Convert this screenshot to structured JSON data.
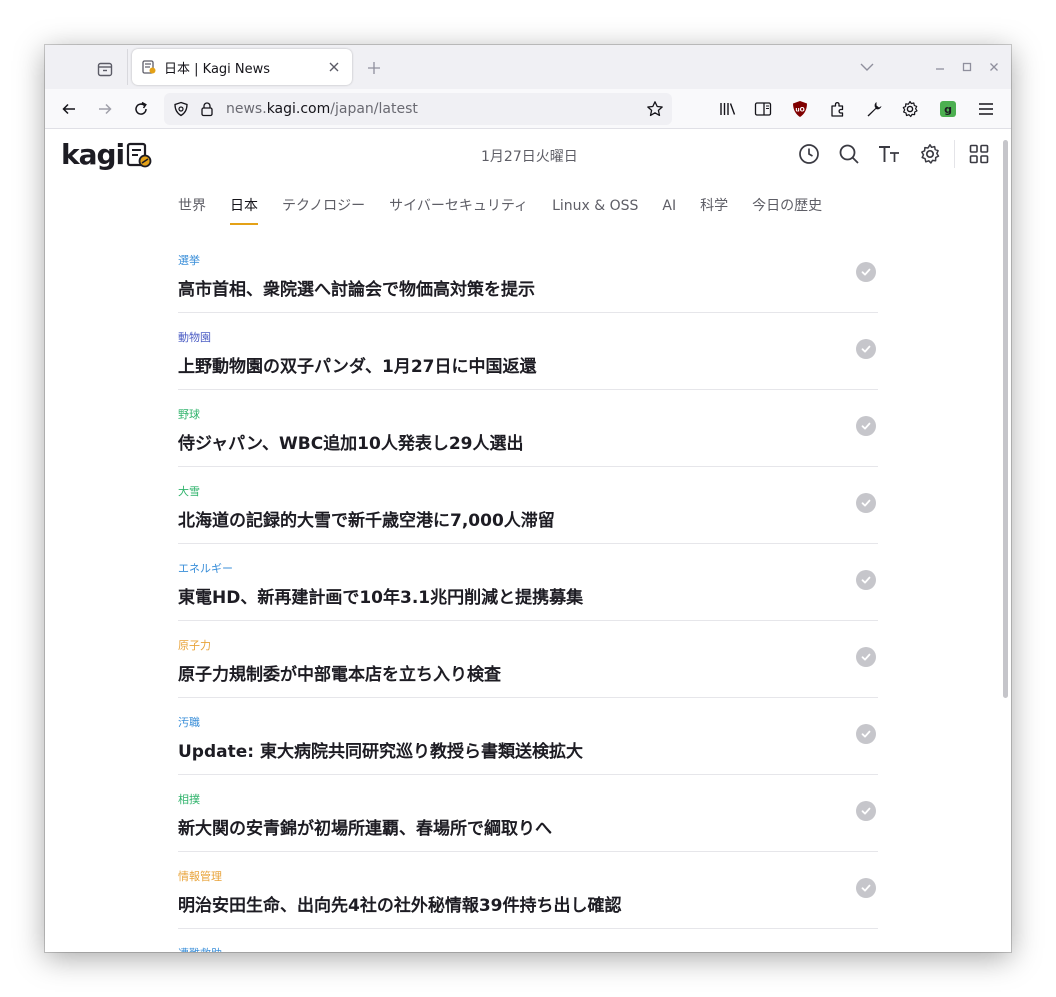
{
  "browser": {
    "tab": {
      "title": "日本 | Kagi News"
    },
    "url": {
      "prefix": "news.",
      "host": "kagi.com",
      "path": "/japan/latest"
    }
  },
  "page": {
    "logo_text": "kagi",
    "date": "1月27日火曜日",
    "categories": [
      {
        "label": "世界"
      },
      {
        "label": "日本",
        "active": true
      },
      {
        "label": "テクノロジー"
      },
      {
        "label": "サイバーセキュリティ"
      },
      {
        "label": "Linux & OSS"
      },
      {
        "label": "AI"
      },
      {
        "label": "科学"
      },
      {
        "label": "今日の歴史"
      }
    ],
    "stories": [
      {
        "tag": "選挙",
        "tag_color": "#3b8fd9",
        "headline": "高市首相、衆院選へ討論会で物価高対策を提示"
      },
      {
        "tag": "動物園",
        "tag_color": "#4b5cc4",
        "headline": "上野動物園の双子パンダ、1月27日に中国返還"
      },
      {
        "tag": "野球",
        "tag_color": "#2fb36b",
        "headline": "侍ジャパン、WBC追加10人発表し29人選出"
      },
      {
        "tag": "大雪",
        "tag_color": "#2fb36b",
        "headline": "北海道の記録的大雪で新千歳空港に7,000人滞留"
      },
      {
        "tag": "エネルギー",
        "tag_color": "#3b8fd9",
        "headline": "東電HD、新再建計画で10年3.1兆円削減と提携募集"
      },
      {
        "tag": "原子力",
        "tag_color": "#e8a33a",
        "headline": "原子力規制委が中部電本店を立ち入り検査"
      },
      {
        "tag": "汚職",
        "tag_color": "#3b8fd9",
        "headline": "Update: 東大病院共同研究巡り教授ら書類送検拡大"
      },
      {
        "tag": "相撲",
        "tag_color": "#2fb36b",
        "headline": "新大関の安青錦が初場所連覇、春場所で綱取りへ"
      },
      {
        "tag": "情報管理",
        "tag_color": "#e8a33a",
        "headline": "明治安田生命、出向先4社の社外秘情報39件持ち出し確認"
      },
      {
        "tag": "遭難救助",
        "tag_color": "#3b8fd9",
        "headline": ""
      }
    ]
  }
}
